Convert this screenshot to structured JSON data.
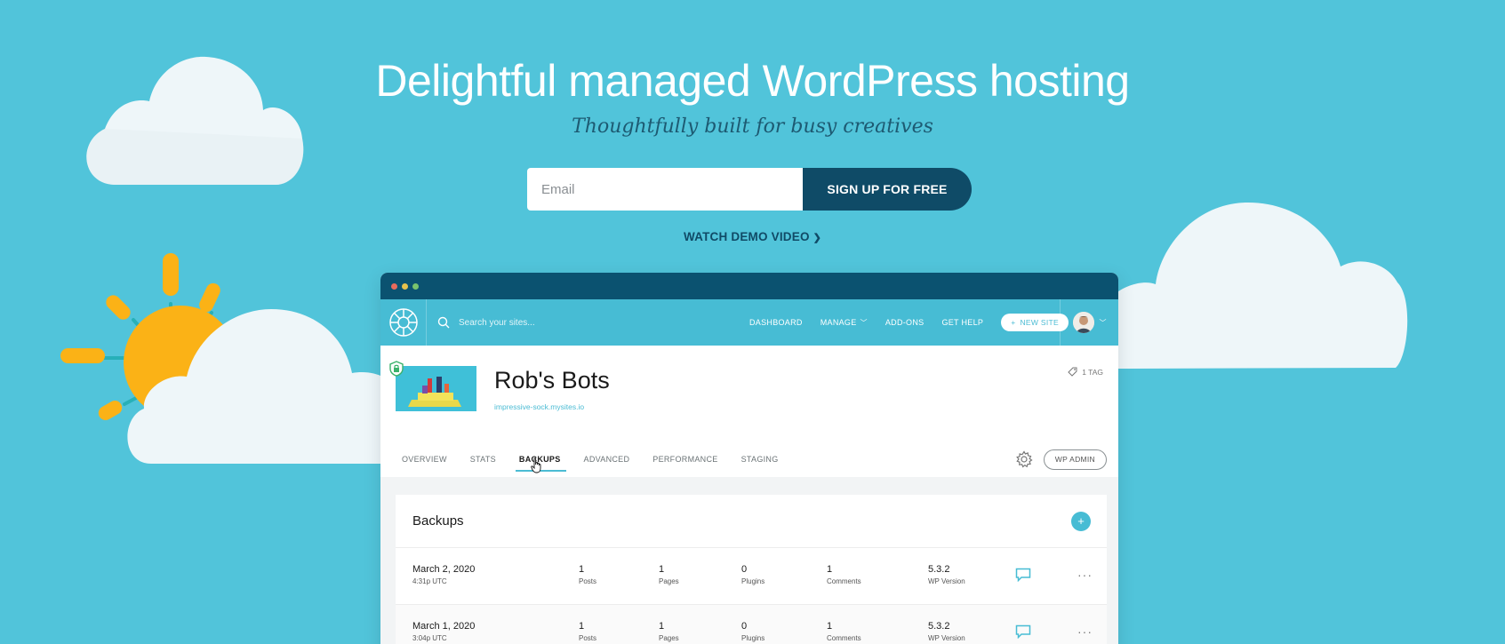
{
  "hero": {
    "title": "Delightful managed WordPress hosting",
    "subtitle": "Thoughtfully built for busy creatives",
    "email_placeholder": "Email",
    "signup_label": "SIGN UP FOR FREE",
    "demo_label": "WATCH DEMO VIDEO",
    "demo_chevron": "❯"
  },
  "app": {
    "search_placeholder": "Search your sites...",
    "menu": {
      "dashboard": "DASHBOARD",
      "manage": "MANAGE",
      "addons": "ADD-ONS",
      "help": "GET HELP",
      "new_site": "NEW SITE"
    },
    "site": {
      "title": "Rob's Bots",
      "url": "impressive-sock.mysites.io",
      "tag": "1 TAG"
    },
    "tabs": [
      "OVERVIEW",
      "STATS",
      "BACKUPS",
      "ADVANCED",
      "PERFORMANCE",
      "STAGING"
    ],
    "active_tab": "BACKUPS",
    "wp_admin": "WP ADMIN",
    "backups": {
      "title": "Backups",
      "add": "+",
      "rows": [
        {
          "date": "March 2, 2020",
          "time": "4:31p UTC",
          "posts": "1",
          "posts_label": "Posts",
          "pages": "1",
          "pages_label": "Pages",
          "plugins": "0",
          "plugins_label": "Plugins",
          "comments": "1",
          "comments_label": "Comments",
          "version": "5.3.2",
          "version_label": "WP Version",
          "more": "···"
        },
        {
          "date": "March 1, 2020",
          "time": "3:04p UTC",
          "posts": "1",
          "posts_label": "Posts",
          "pages": "1",
          "pages_label": "Pages",
          "plugins": "0",
          "plugins_label": "Plugins",
          "comments": "1",
          "comments_label": "Comments",
          "version": "5.3.2",
          "version_label": "WP Version",
          "more": "···"
        }
      ]
    }
  },
  "colors": {
    "background": "#51c4da",
    "navy": "#0f4b67",
    "accent": "#47bcd4",
    "sun": "#fbb216"
  }
}
